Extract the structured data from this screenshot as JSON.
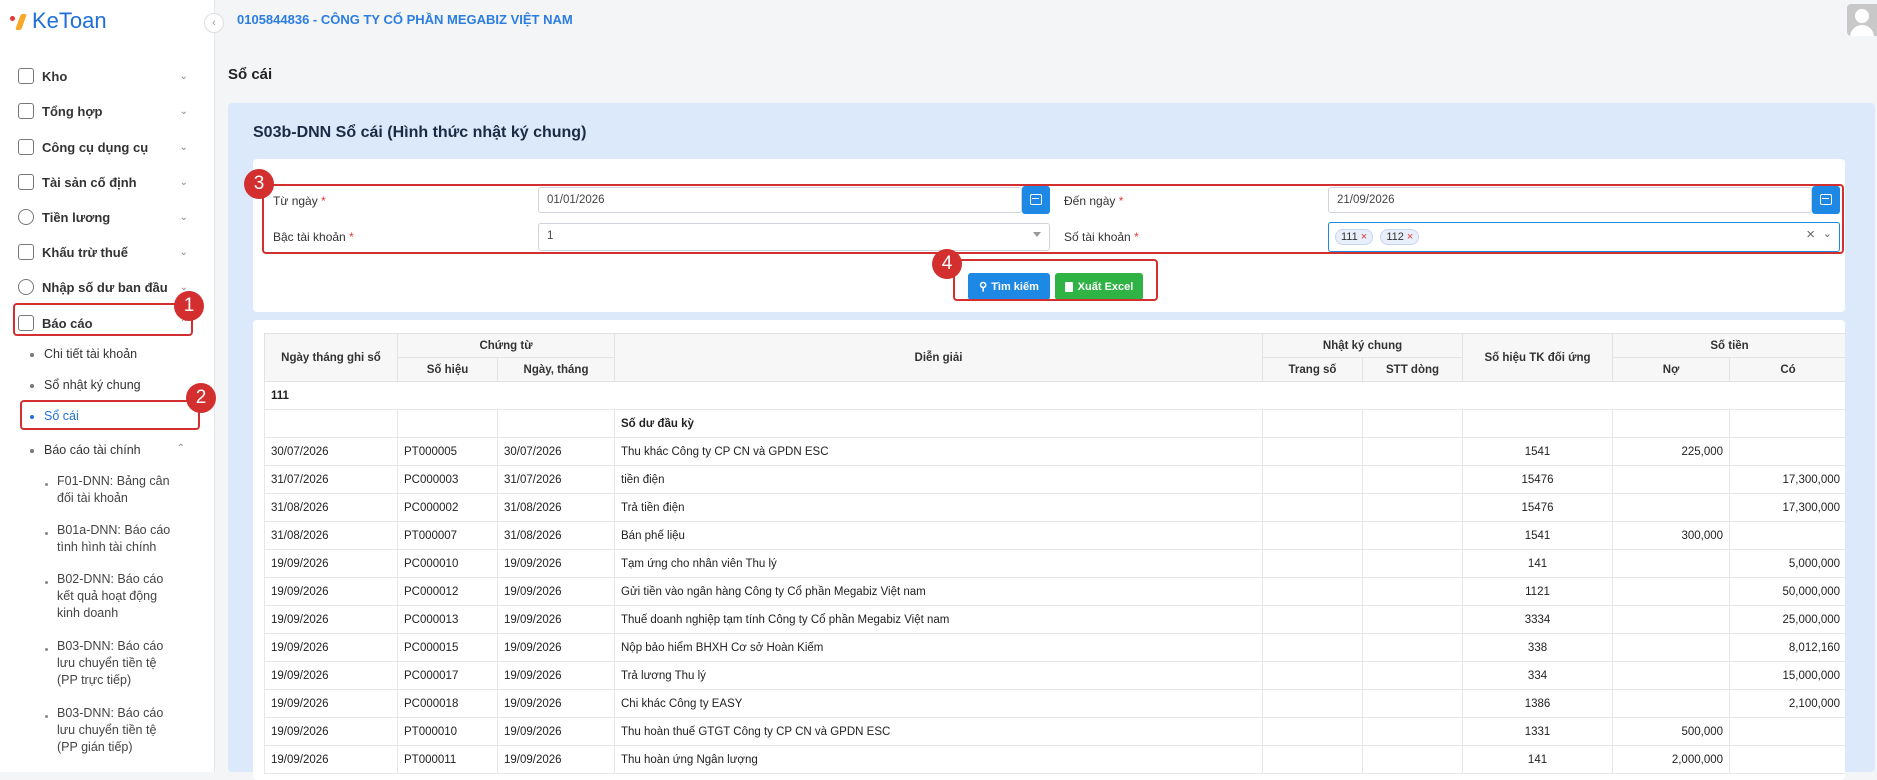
{
  "app": {
    "name": "KeToan",
    "company": "0105844836 - CÔNG TY CỔ PHẦN MEGABIZ VIỆT NAM"
  },
  "sidebar": {
    "items": [
      {
        "label": "Kho",
        "icon": "warehouse-icon"
      },
      {
        "label": "Tổng hợp",
        "icon": "chart-line-icon"
      },
      {
        "label": "Công cụ dụng cụ",
        "icon": "toolbox-icon"
      },
      {
        "label": "Tài sản cố định",
        "icon": "car-icon"
      },
      {
        "label": "Tiền lương",
        "icon": "dollar-icon"
      },
      {
        "label": "Khấu trừ thuế",
        "icon": "bank-icon"
      },
      {
        "label": "Nhập số dư ban đầu",
        "icon": "edit-icon"
      },
      {
        "label": "Báo cáo",
        "icon": "box-icon"
      }
    ],
    "report_children": [
      {
        "label": "Chi tiết tài khoản"
      },
      {
        "label": "Sổ nhật ký chung"
      },
      {
        "label": "Sổ cái"
      },
      {
        "label": "Báo cáo tài chính"
      }
    ],
    "financial_children": [
      {
        "label": "F01-DNN: Bảng cân đối tài khoản"
      },
      {
        "label": "B01a-DNN: Báo cáo tình hình tài chính"
      },
      {
        "label": "B02-DNN: Báo cáo kết quả hoạt động kinh doanh"
      },
      {
        "label": "B03-DNN: Báo cáo lưu chuyển tiền tệ (PP trực tiếp)"
      },
      {
        "label": "B03-DNN: Báo cáo lưu chuyển tiền tệ (PP gián tiếp)"
      }
    ]
  },
  "callouts": [
    "1",
    "2",
    "3",
    "4"
  ],
  "page": {
    "title": "Sổ cái",
    "panel_title": "S03b-DNN Sổ cái (Hình thức nhật ký chung)"
  },
  "filters": {
    "from_date_label": "Từ ngày",
    "from_date": "01/01/2026",
    "to_date_label": "Đến ngày",
    "to_date": "21/09/2026",
    "level_label": "Bậc tài khoản",
    "level": "1",
    "account_label": "Số tài khoản",
    "accounts": [
      "111",
      "112"
    ],
    "required_mark": "*",
    "search_btn": "Tìm kiếm",
    "excel_btn": "Xuất Excel"
  },
  "table": {
    "headers": {
      "date": "Ngày tháng ghi sổ",
      "voucher": "Chứng từ",
      "voucher_no": "Số hiệu",
      "voucher_date": "Ngày, tháng",
      "desc": "Diễn giải",
      "journal": "Nhật ký chung",
      "page_no": "Trang số",
      "line_no": "STT dòng",
      "contra": "Số hiệu TK đối ứng",
      "amount": "Số tiền",
      "debit": "Nợ",
      "credit": "Có"
    },
    "group": "111",
    "opening_label": "Số dư đầu kỳ",
    "rows": [
      [
        "30/07/2026",
        "PT000005",
        "30/07/2026",
        "Thu khác Công ty CP CN và GPDN ESC",
        "",
        "",
        "1541",
        "225,000",
        ""
      ],
      [
        "31/07/2026",
        "PC000003",
        "31/07/2026",
        "tiền điện",
        "",
        "",
        "15476",
        "",
        "17,300,000"
      ],
      [
        "31/08/2026",
        "PC000002",
        "31/08/2026",
        "Trả tiền điện",
        "",
        "",
        "15476",
        "",
        "17,300,000"
      ],
      [
        "31/08/2026",
        "PT000007",
        "31/08/2026",
        "Bán phế liệu",
        "",
        "",
        "1541",
        "300,000",
        ""
      ],
      [
        "19/09/2026",
        "PC000010",
        "19/09/2026",
        "Tạm ứng cho nhân viên Thu lý",
        "",
        "",
        "141",
        "",
        "5,000,000"
      ],
      [
        "19/09/2026",
        "PC000012",
        "19/09/2026",
        "Gửi tiền vào ngân hàng Công ty Cổ phần Megabiz Việt nam",
        "",
        "",
        "1121",
        "",
        "50,000,000"
      ],
      [
        "19/09/2026",
        "PC000013",
        "19/09/2026",
        "Thuế doanh nghiệp tạm tính Công ty Cổ phần Megabiz Việt nam",
        "",
        "",
        "3334",
        "",
        "25,000,000"
      ],
      [
        "19/09/2026",
        "PC000015",
        "19/09/2026",
        "Nộp bảo hiểm BHXH Cơ sở Hoàn Kiếm",
        "",
        "",
        "338",
        "",
        "8,012,160"
      ],
      [
        "19/09/2026",
        "PC000017",
        "19/09/2026",
        "Trả lương Thu lý",
        "",
        "",
        "334",
        "",
        "15,000,000"
      ],
      [
        "19/09/2026",
        "PC000018",
        "19/09/2026",
        "Chi khác Công ty EASY",
        "",
        "",
        "1386",
        "",
        "2,100,000"
      ],
      [
        "19/09/2026",
        "PT000010",
        "19/09/2026",
        "Thu hoàn thuế GTGT Công ty CP CN và GPDN ESC",
        "",
        "",
        "1331",
        "500,000",
        ""
      ],
      [
        "19/09/2026",
        "PT000011",
        "19/09/2026",
        "Thu hoàn ứng Ngân lượng",
        "",
        "",
        "141",
        "2,000,000",
        ""
      ]
    ]
  }
}
